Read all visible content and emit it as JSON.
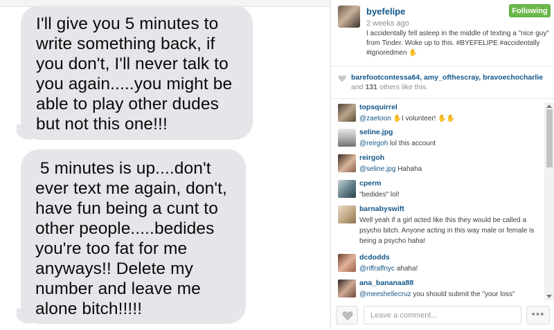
{
  "photo": {
    "messages": [
      {
        "lines": [
          "I'll give you 5 minutes to",
          "write something back, if",
          "you don't,  I'll never talk to",
          "you again.....you might be",
          "able to play other dudes",
          "but not this one!!!"
        ]
      },
      {
        "lines": [
          " 5 minutes is up....don't",
          "ever text me again, don't,",
          "have fun being a cunt to",
          "other people.....bedides",
          "you're too fat for me",
          "anyways!! Delete my",
          "number and leave me",
          "alone bitch!!!!!"
        ]
      }
    ]
  },
  "post": {
    "owner": "byefelipe",
    "follow_label": "Following",
    "time_ago": "2 weeks ago",
    "caption": "I accidentally fell asleep in the middle of texting a \"nice guy\" from Tinder. Woke up to this. #BYEFELIPE #accidentally #ignoredmen ✋"
  },
  "likes": {
    "likers": [
      "barefootcontessa64",
      "amy_ofthescray",
      "bravoechocharlie"
    ],
    "separator": ", ",
    "others_prefix": "and ",
    "others_count": "131",
    "others_suffix": " others like this."
  },
  "comments": [
    {
      "user": "topsquirrel",
      "mention": "@zaetoon",
      "text": " ✋I volunteer! ✋✋"
    },
    {
      "user": "seline.jpg",
      "mention": "@reirgoh",
      "text": " lol this account"
    },
    {
      "user": "reirgoh",
      "mention": "@seline.jpg",
      "text": " Hahaha"
    },
    {
      "user": "cperm",
      "mention": "",
      "text": "\"bedides\" lol!"
    },
    {
      "user": "barnabyswift",
      "mention": "",
      "text": "Well yeah if a girl acted like this they would be called a psycho bitch. Anyone acting in this way male or female is being a psycho haha!"
    },
    {
      "user": "dcdodds",
      "mention": "@riffraffnyc",
      "text": " ahaha!"
    },
    {
      "user": "ana_bananaa88",
      "mention": "@meeshellecruz",
      "text": " you should submit the \"your loss\""
    }
  ],
  "footer": {
    "comment_placeholder": "Leave a comment...",
    "more_label": "•••"
  },
  "icons": {
    "like": "heart-icon",
    "more": "more-options-icon"
  },
  "colors": {
    "link": "#125688",
    "follow": "#6bb84b",
    "bubble": "#e5e5ea"
  }
}
